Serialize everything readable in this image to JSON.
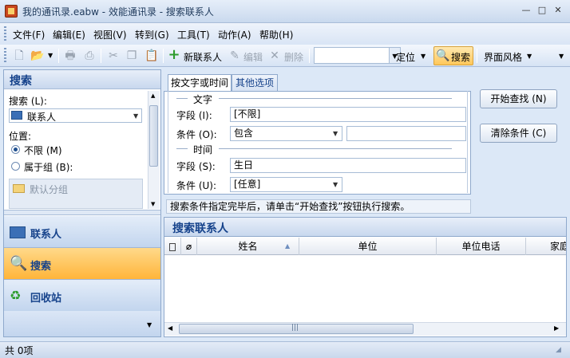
{
  "window": {
    "title": "我的通讯录.eabw - 效能通讯录 - 搜索联系人",
    "minimize": "—",
    "maximize": "□",
    "close": "✕"
  },
  "menu": [
    "文件(F)",
    "编辑(E)",
    "视图(V)",
    "转到(G)",
    "工具(T)",
    "动作(A)",
    "帮助(H)"
  ],
  "toolbar": {
    "new_contact": "新联系人",
    "edit": "编辑",
    "delete": "删除",
    "locate": "定位",
    "search": "搜索",
    "skin": "界面风格",
    "search_value": ""
  },
  "left": {
    "header": "搜索",
    "search_label": "搜索 (L):",
    "search_value": "联系人",
    "position_label": "位置:",
    "radio_all": "不限 (M)",
    "radio_group": "属于组 (B):",
    "default_group": "默认分组",
    "nav": [
      "联系人",
      "搜索",
      "回收站"
    ]
  },
  "criteria": {
    "tab_text": "按文字或时间",
    "tab_other": "其他选项",
    "section_text": "文字",
    "field_label": "字段 (I):",
    "field_value": "[不限]",
    "condition_label": "条件 (O):",
    "condition_value": "包含",
    "condition_text": "",
    "section_time": "时间",
    "time_field_label": "字段 (S):",
    "time_field_value": "生日",
    "time_condition_label": "条件 (U):",
    "time_condition_value": "[任意]"
  },
  "buttons": {
    "start": "开始查找 (N)",
    "clear": "清除条件 (C)"
  },
  "hint": "搜索条件指定完毕后，请单击“开始查找”按钮执行搜索。",
  "results": {
    "title": "搜索联系人",
    "columns": [
      "姓名",
      "单位",
      "单位电话",
      "家庭"
    ]
  },
  "status": {
    "count": "共 0项"
  },
  "colors": {
    "accent": "#15428b",
    "active_nav": "#ffb53a",
    "border": "#8fa9cc"
  }
}
